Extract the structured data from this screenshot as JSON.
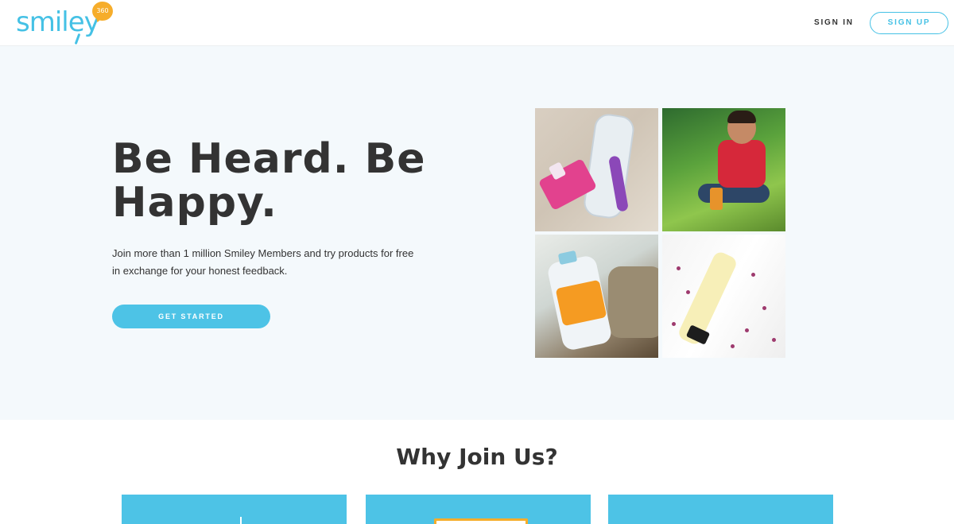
{
  "header": {
    "logo_text": "smiley",
    "logo_badge": "360",
    "sign_in": "SIGN IN",
    "sign_up": "SIGN UP"
  },
  "hero": {
    "title_line1": "Be Heard. Be",
    "title_line2": "Happy.",
    "subtitle_line1": "Join more than 1 million Smiley Members and try products for free",
    "subtitle_line2": "in exchange for your honest feedback.",
    "cta": "GET STARTED",
    "images": [
      "shaver-and-lotion-photo",
      "child-on-slide-photo",
      "laundry-detergent-photo",
      "purity-cream-photo"
    ]
  },
  "why": {
    "title": "Why Join Us?"
  },
  "colors": {
    "accent": "#45c1e5",
    "badge": "#f6ad2b",
    "hero_bg": "#f4f9fc",
    "text": "#333333"
  }
}
